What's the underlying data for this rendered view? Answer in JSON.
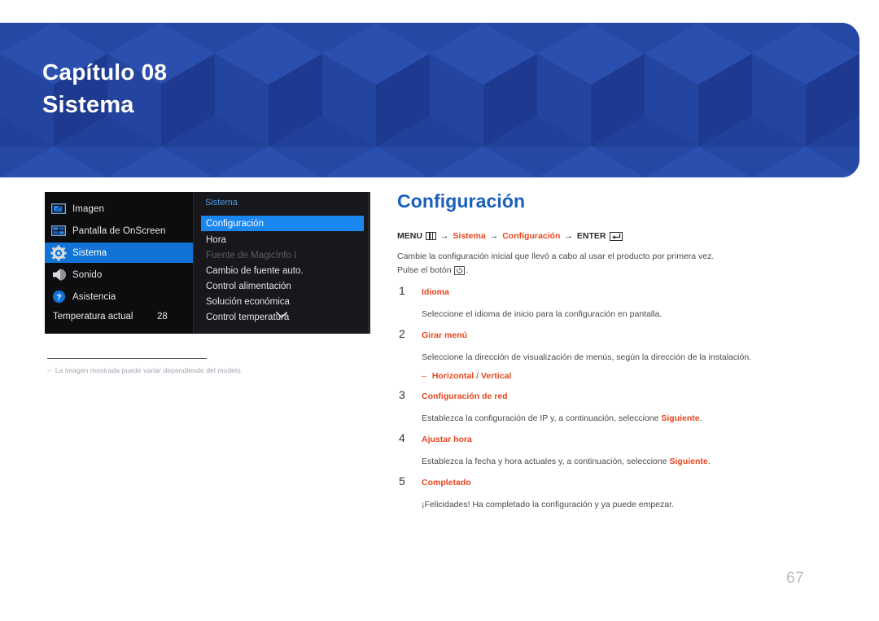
{
  "banner": {
    "chapter_label": "Capítulo 08",
    "chapter_title": "Sistema",
    "bg_color": "#20409a"
  },
  "osd": {
    "left_menu": [
      {
        "label": "Imagen",
        "icon": "picture-icon",
        "selected": false
      },
      {
        "label": "Pantalla de OnScreen",
        "icon": "onscreen-display-icon",
        "selected": false
      },
      {
        "label": "Sistema",
        "icon": "gear-icon",
        "selected": true
      },
      {
        "label": "Sonido",
        "icon": "speaker-icon",
        "selected": false
      },
      {
        "label": "Asistencia",
        "icon": "question-mark-icon",
        "selected": false
      }
    ],
    "temperature_label": "Temperatura actual",
    "temperature_value": "28",
    "panel_title": "Sistema",
    "sub_items": [
      {
        "label": "Configuración",
        "state": "selected"
      },
      {
        "label": "Hora",
        "state": "normal"
      },
      {
        "label": "Fuente de MagicInfo I",
        "state": "disabled"
      },
      {
        "label": "Cambio de fuente auto.",
        "state": "normal"
      },
      {
        "label": "Control alimentación",
        "state": "normal"
      },
      {
        "label": "Solución económica",
        "state": "normal"
      },
      {
        "label": "Control temperatura",
        "state": "normal"
      }
    ],
    "scroll_down_icon": "chevron-down-icon",
    "highlight_color": "#1a86f0"
  },
  "footnote": {
    "dash": "‒",
    "text": "La imagen mostrada puede variar dependiendo del modelo."
  },
  "article": {
    "title": "Configuración",
    "menu_path": {
      "menu_word": "MENU",
      "menu_icon": "menu-grid-icon",
      "arrow": "→",
      "step1": "Sistema",
      "step2": "Configuración",
      "enter_word": "ENTER",
      "enter_icon": "enter-key-icon"
    },
    "intro_line1": "Cambie la configuración inicial que llevó a cabo al usar el producto por primera vez.",
    "intro_line2_pre": "Pulse el botón ",
    "intro_line2_icon": "power-button-icon",
    "intro_line2_post": ".",
    "accent_color": "#e8461e",
    "title_color": "#1a5fbe",
    "steps": [
      {
        "num": "1",
        "title": "Idioma",
        "desc": "Seleccione el idioma de inicio para la configuración en pantalla."
      },
      {
        "num": "2",
        "title": "Girar menú",
        "desc": "Seleccione la dirección de visualización de menús, según la dirección de la instalación.",
        "bullet_dash": "‒",
        "bullet_a": "Horizontal",
        "bullet_sep": " / ",
        "bullet_b": "Vertical"
      },
      {
        "num": "3",
        "title": "Configuración de red",
        "desc_pre": "Establezca la configuración de IP y, a continuación, seleccione ",
        "desc_bold": "Siguiente",
        "desc_post": "."
      },
      {
        "num": "4",
        "title": "Ajustar hora",
        "desc_pre": "Establezca la fecha y hora actuales y, a continuación, seleccione ",
        "desc_bold": "Siguiente",
        "desc_post": "."
      },
      {
        "num": "5",
        "title": "Completado",
        "desc": "¡Felicidades! Ha completado la configuración y ya puede empezar."
      }
    ]
  },
  "page_number": "67"
}
